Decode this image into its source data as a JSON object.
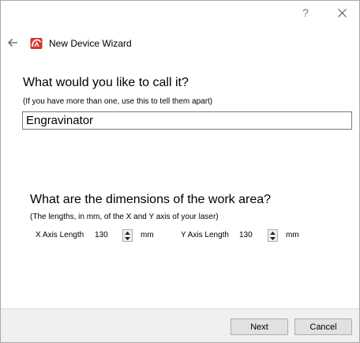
{
  "window": {
    "help_glyph": "?",
    "close_icon": "close-icon"
  },
  "header": {
    "back_icon": "arrow-left-icon",
    "logo_icon": "app-logo-icon",
    "title": "New Device Wizard"
  },
  "name_section": {
    "heading": "What would you like to call it?",
    "hint": "(If you have more than one, use this to tell them apart)",
    "value": "Engravinator"
  },
  "dimensions_section": {
    "heading": "What are the dimensions of the work area?",
    "hint": "(The lengths, in mm, of the X and Y axis of your laser)",
    "x_axis": {
      "label": "X Axis Length",
      "value": "130",
      "unit": "mm"
    },
    "y_axis": {
      "label": "Y Axis Length",
      "value": "130",
      "unit": "mm"
    }
  },
  "footer": {
    "next_label": "Next",
    "cancel_label": "Cancel"
  },
  "colors": {
    "logo_red": "#d6332b",
    "footer_bg": "#f0f0f0",
    "button_bg": "#e1e1e1"
  }
}
